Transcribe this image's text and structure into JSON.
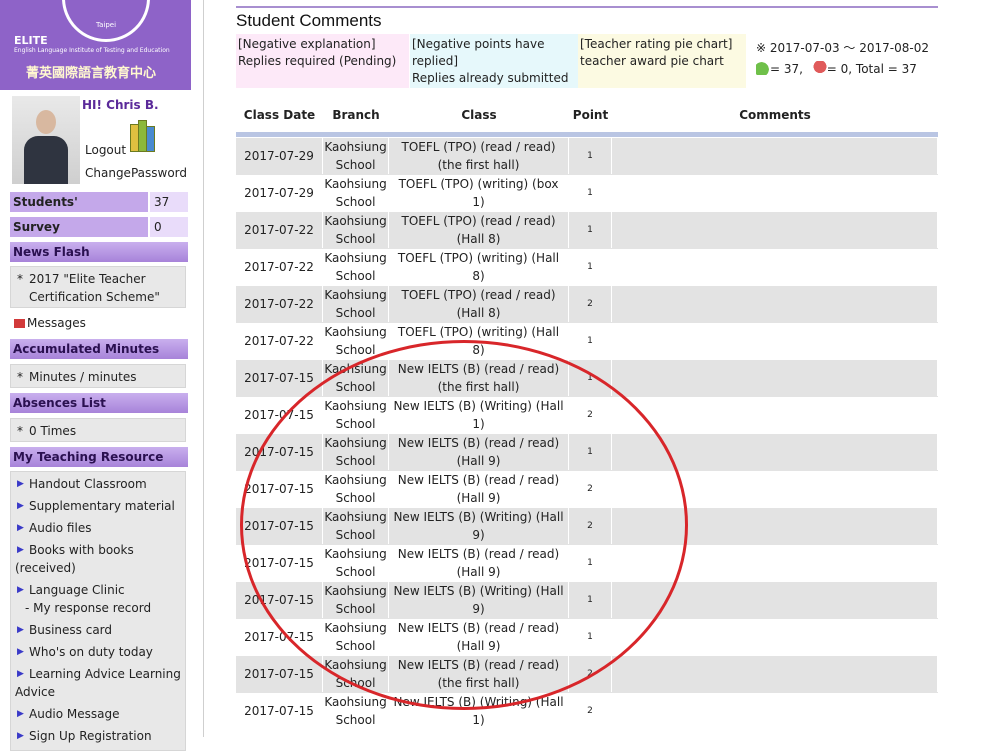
{
  "logo": {
    "brand": "ELITE",
    "tagline": "English Language Institute of Testing and Education",
    "chinese_name": "菁英國際語言教育中心",
    "seal_text": "Taipei"
  },
  "user": {
    "greeting": "HI! Chris B.",
    "logout": "Logout",
    "change_password": "ChangePassword"
  },
  "sidebar": {
    "students_comments": {
      "label": "Students' comments",
      "count": "37"
    },
    "survey": {
      "label": "Survey",
      "count": "0"
    },
    "news_flash": {
      "title": "News Flash",
      "items": [
        "2017 \"Elite Teacher Certification Scheme\""
      ]
    },
    "messages": "Messages",
    "accumulated": {
      "title": "Accumulated Minutes",
      "value": "Minutes / minutes"
    },
    "absences": {
      "title": "Absences List",
      "value": "0 Times"
    },
    "teaching": {
      "title": "My Teaching Resource",
      "items": [
        "Handout Classroom",
        "Supplementary material",
        "Audio files",
        "Books with books (received)",
        "Language Clinic",
        "Business card",
        "Who's on duty today",
        "Learning Advice Learning Advice",
        "Audio Message",
        "Sign Up Registration"
      ],
      "sub": "- My response record"
    }
  },
  "page": {
    "title": "Student Comments",
    "legend1": [
      "[Negative explanation]",
      "Replies required (Pending)"
    ],
    "legend2": [
      "[Negative points have replied]",
      "Replies already submitted"
    ],
    "legend3": [
      "[Teacher rating pie chart]",
      "teacher award pie chart"
    ],
    "summary": {
      "range": "※ 2017-07-03 ～ 2017-08-02",
      "positive": "= 37,",
      "negative": "= 0, Total = 37"
    }
  },
  "table": {
    "headers": {
      "date": "Class Date",
      "branch": "Branch",
      "class": "Class",
      "point": "Point",
      "comments": "Comments"
    },
    "rows": [
      {
        "date": "2017-07-29",
        "branch": "Kaohsiung School",
        "class": "TOEFL (TPO) (read / read) (the first hall)",
        "point": "1",
        "comment": ""
      },
      {
        "date": "2017-07-29",
        "branch": "Kaohsiung School",
        "class": "TOEFL (TPO) (writing) (box 1)",
        "point": "1",
        "comment": ""
      },
      {
        "date": "2017-07-22",
        "branch": "Kaohsiung School",
        "class": "TOEFL (TPO) (read / read) (Hall 8)",
        "point": "1",
        "comment": ""
      },
      {
        "date": "2017-07-22",
        "branch": "Kaohsiung School",
        "class": "TOEFL (TPO) (writing) (Hall 8)",
        "point": "1",
        "comment": ""
      },
      {
        "date": "2017-07-22",
        "branch": "Kaohsiung School",
        "class": "TOEFL (TPO) (read / read) (Hall 8)",
        "point": "2",
        "comment": ""
      },
      {
        "date": "2017-07-22",
        "branch": "Kaohsiung School",
        "class": "TOEFL (TPO) (writing) (Hall 8)",
        "point": "1",
        "comment": ""
      },
      {
        "date": "2017-07-15",
        "branch": "Kaohsiung School",
        "class": "New IELTS (B) (read / read) (the first hall)",
        "point": "1",
        "comment": ""
      },
      {
        "date": "2017-07-15",
        "branch": "Kaohsiung School",
        "class": "New IELTS (B) (Writing) (Hall 1)",
        "point": "2",
        "comment": ""
      },
      {
        "date": "2017-07-15",
        "branch": "Kaohsiung School",
        "class": "New IELTS (B) (read / read) (Hall 9)",
        "point": "1",
        "comment": ""
      },
      {
        "date": "2017-07-15",
        "branch": "Kaohsiung School",
        "class": "New IELTS (B) (read / read) (Hall 9)",
        "point": "2",
        "comment": ""
      },
      {
        "date": "2017-07-15",
        "branch": "Kaohsiung School",
        "class": "New IELTS (B) (Writing) (Hall 9)",
        "point": "2",
        "comment": ""
      },
      {
        "date": "2017-07-15",
        "branch": "Kaohsiung School",
        "class": "New IELTS (B) (read / read) (Hall 9)",
        "point": "1",
        "comment": ""
      },
      {
        "date": "2017-07-15",
        "branch": "Kaohsiung School",
        "class": "New IELTS (B) (Writing) (Hall 9)",
        "point": "1",
        "comment": ""
      },
      {
        "date": "2017-07-15",
        "branch": "Kaohsiung School",
        "class": "New IELTS (B) (read / read) (Hall 9)",
        "point": "1",
        "comment": ""
      },
      {
        "date": "2017-07-15",
        "branch": "Kaohsiung School",
        "class": "New IELTS (B) (read / read) (the first hall)",
        "point": "2",
        "comment": ""
      },
      {
        "date": "2017-07-15",
        "branch": "Kaohsiung School",
        "class": "New IELTS (B) (Writing) (Hall 1)",
        "point": "2",
        "comment": ""
      }
    ]
  }
}
